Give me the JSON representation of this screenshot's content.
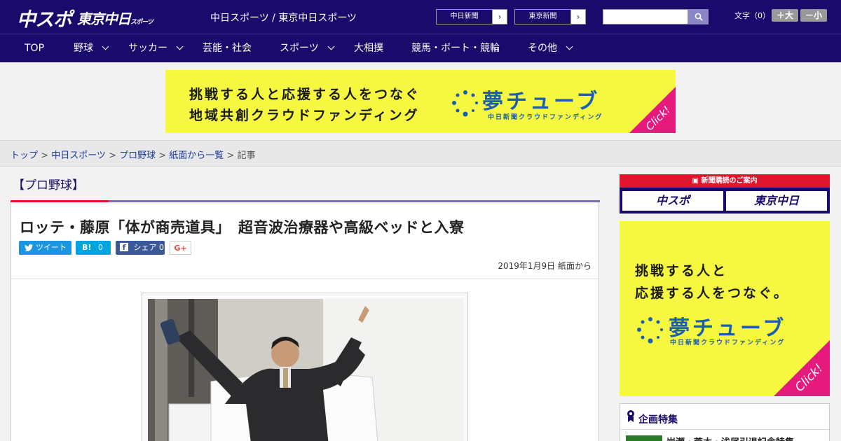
{
  "header": {
    "logo_main": "中スポ",
    "logo_sub": "東京中日",
    "logo_sub_small": "スポーツ",
    "site_title": "中日スポーツ / 東京中日スポーツ",
    "paper_links": [
      "中日新聞",
      "東京新聞"
    ],
    "search_placeholder": "",
    "text_size_label": "文字（0）",
    "size_up": "＋大",
    "size_down": "－小"
  },
  "nav": {
    "items": [
      {
        "label": "TOP"
      },
      {
        "label": "野球"
      },
      {
        "label": "サッカー"
      },
      {
        "label": "芸能・社会"
      },
      {
        "label": "スポーツ"
      },
      {
        "label": "大相撲"
      },
      {
        "label": "競馬・ボート・競輪"
      },
      {
        "label": "その他"
      }
    ]
  },
  "ad_top": {
    "line1": "挑戦する人と応援する人をつなぐ",
    "line2": "地域共創クラウドファンディング",
    "brand": "夢チューブ",
    "brand_sub": "中日新聞クラウドファンディング",
    "click": "Click!"
  },
  "breadcrumb": {
    "items": [
      "トップ",
      "中日スポーツ",
      "プロ野球",
      "紙面から一覧"
    ],
    "current": "記事",
    "sep": " > "
  },
  "article": {
    "category": "【プロ野球】",
    "headline": "ロッテ・藤原「体が商売道具」　超音波治療器や高級ベッドと入寮",
    "share": {
      "tweet": "ツイート",
      "hatena": "0",
      "facebook": "シェア 0",
      "gplus": "G+"
    },
    "date": "2019年1月9日 紙面から"
  },
  "sidebar": {
    "subscribe_head": "新聞購読のご案内",
    "subscribe_buttons": [
      "中スポ",
      "東京中日"
    ],
    "ad_line1": "挑戦する人と",
    "ad_line2": "応援する人をつなぐ。",
    "ad_brand": "夢チューブ",
    "ad_brand_sub": "中日新聞クラウドファンディング",
    "ad_click": "Click!",
    "feature_title": "企画特集",
    "feature_item": "岩瀬・荒木・浅尾引退記念特集"
  },
  "colors": {
    "navy": "#1a0a6b",
    "red": "#e0142c",
    "ad_yellow": "#f5f741",
    "ad_pink": "#e6197d",
    "brand_blue": "#1b5eb0"
  }
}
